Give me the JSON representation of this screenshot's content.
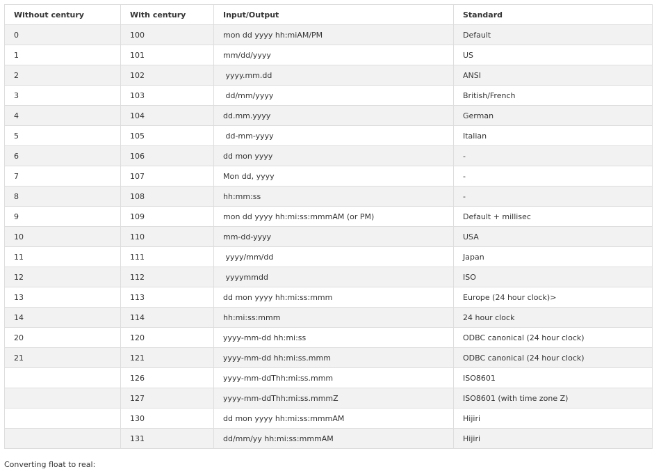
{
  "table": {
    "headers": [
      "Without century",
      "With century",
      "Input/Output",
      "Standard"
    ],
    "rows": [
      [
        "0",
        "100",
        "mon dd yyyy hh:miAM/PM",
        "Default"
      ],
      [
        "1",
        "101",
        "mm/dd/yyyy",
        "US"
      ],
      [
        "2",
        "102",
        " yyyy.mm.dd",
        "ANSI"
      ],
      [
        "3",
        "103",
        " dd/mm/yyyy",
        "British/French"
      ],
      [
        "4",
        "104",
        "dd.mm.yyyy",
        "German"
      ],
      [
        "5",
        "105",
        " dd-mm-yyyy",
        "Italian"
      ],
      [
        "6",
        "106",
        "dd mon yyyy",
        "-"
      ],
      [
        "7",
        "107",
        "Mon dd, yyyy",
        "-"
      ],
      [
        "8",
        "108",
        "hh:mm:ss",
        "-"
      ],
      [
        "9",
        "109",
        "mon dd yyyy hh:mi:ss:mmmAM (or PM)",
        "Default + millisec"
      ],
      [
        "10",
        "110",
        "mm-dd-yyyy",
        "USA"
      ],
      [
        "11",
        "111",
        " yyyy/mm/dd",
        "Japan"
      ],
      [
        "12",
        "112",
        " yyyymmdd",
        "ISO"
      ],
      [
        "13",
        "113",
        "dd mon yyyy hh:mi:ss:mmm",
        "Europe (24 hour clock)>"
      ],
      [
        "14",
        "114",
        "hh:mi:ss:mmm",
        "24 hour clock"
      ],
      [
        "20",
        "120",
        "yyyy-mm-dd hh:mi:ss",
        "ODBC canonical (24 hour clock)"
      ],
      [
        "21",
        "121",
        "yyyy-mm-dd hh:mi:ss.mmm",
        "ODBC canonical (24 hour clock)"
      ],
      [
        "",
        "126",
        "yyyy-mm-ddThh:mi:ss.mmm",
        "ISO8601"
      ],
      [
        "",
        "127",
        "yyyy-mm-ddThh:mi:ss.mmmZ",
        "ISO8601 (with time zone Z)"
      ],
      [
        "",
        "130",
        "dd mon yyyy hh:mi:ss:mmmAM",
        "Hijiri"
      ],
      [
        "",
        "131",
        "dd/mm/yy hh:mi:ss:mmmAM",
        "Hijiri"
      ]
    ]
  },
  "footer_text": "Converting float to real:"
}
